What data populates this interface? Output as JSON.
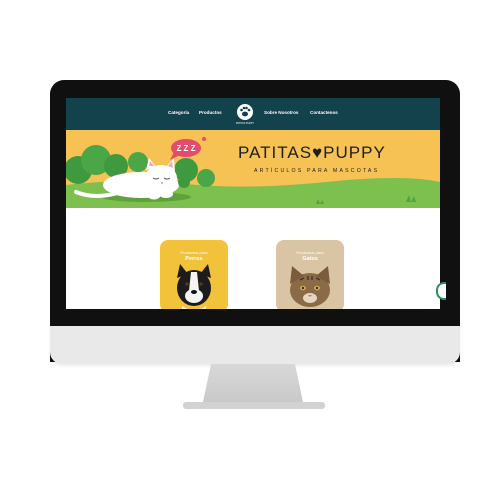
{
  "nav": {
    "items": [
      "Categoría",
      "Productos",
      "Sobre Nosotros",
      "Contactenos"
    ],
    "logo_text": "PATITAS PUPPY"
  },
  "hero": {
    "title": "PATITAS♥PUPPY",
    "subtitle": "ARTÍCULOS PARA MASCOTAS",
    "sleep_text": "Z Z Z"
  },
  "cards": [
    {
      "line1": "Productos para",
      "line2": "Perros",
      "color": "#f2c23a"
    },
    {
      "line1": "Productos para",
      "line2": "Gatos",
      "color": "#d9c4a4"
    }
  ],
  "colors": {
    "nav": "#12424b",
    "hero": "#f5c253",
    "grass": "#7ec04e",
    "accent": "#e54b6a"
  }
}
